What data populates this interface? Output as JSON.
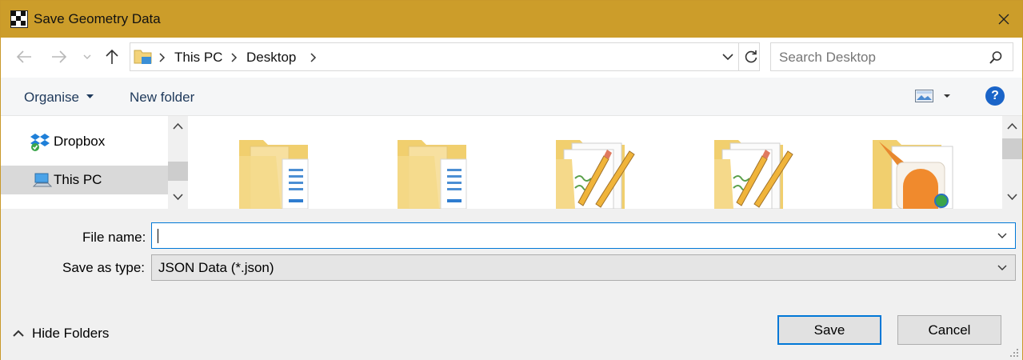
{
  "window": {
    "title": "Save Geometry Data"
  },
  "nav": {
    "path": [
      "This PC",
      "Desktop"
    ],
    "search_placeholder": "Search Desktop"
  },
  "toolbar": {
    "organise_label": "Organise",
    "new_folder_label": "New folder",
    "help_label": "?"
  },
  "sidebar": {
    "items": [
      {
        "label": "Dropbox",
        "icon": "dropbox-icon",
        "selected": false
      },
      {
        "label": "This PC",
        "icon": "computer-icon",
        "selected": true
      }
    ]
  },
  "files": [
    {
      "icon": "folder-documents-icon"
    },
    {
      "icon": "folder-documents-icon"
    },
    {
      "icon": "folder-pencil-icon"
    },
    {
      "icon": "folder-pencil-icon"
    },
    {
      "icon": "folder-app-icon"
    }
  ],
  "form": {
    "file_name_label": "File name:",
    "file_name_value": "",
    "save_type_label": "Save as type:",
    "save_type_value": "JSON Data (*.json)"
  },
  "footer": {
    "hide_folders_label": "Hide Folders",
    "save_label": "Save",
    "cancel_label": "Cancel"
  },
  "colors": {
    "title_bar": "#cc9d2a",
    "accent": "#0078d7",
    "help": "#1a64c8"
  }
}
